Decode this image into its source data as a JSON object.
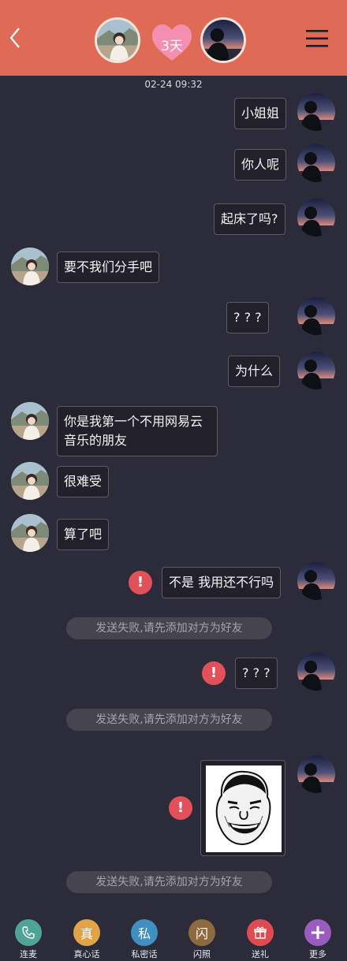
{
  "header": {
    "days_label": "3天",
    "colors": {
      "bar": "#df6a55",
      "heart": "#f48fb1"
    }
  },
  "chat": {
    "timestamp": "02-24 09:32",
    "messages": [
      {
        "side": "right",
        "text": "小姐姐"
      },
      {
        "side": "right",
        "text": "你人呢"
      },
      {
        "side": "right",
        "text": "起床了吗?"
      },
      {
        "side": "left",
        "text": "要不我们分手吧"
      },
      {
        "side": "right",
        "text": "? ? ?"
      },
      {
        "side": "right",
        "text": "为什么"
      },
      {
        "side": "left",
        "text": "你是我第一个不用网易云音乐的朋友"
      },
      {
        "side": "left",
        "text": "很难受"
      },
      {
        "side": "left",
        "text": "算了吧"
      },
      {
        "side": "right",
        "text": "不是 我用还不行吗",
        "failed": true
      },
      {
        "side": "right",
        "text": "? ? ?",
        "failed": true
      },
      {
        "side": "right",
        "type": "image",
        "image": "meme-face",
        "failed": true
      }
    ],
    "system_notice": "发送失败,请先添加对方为好友",
    "error_icon": "exclamation-icon"
  },
  "toolbar": {
    "items": [
      {
        "label": "连麦",
        "icon": "phone-icon",
        "color": "#4ea597"
      },
      {
        "label": "真心话",
        "icon": "truth-icon",
        "glyph": "真",
        "color": "#e0a446"
      },
      {
        "label": "私密话",
        "icon": "private-icon",
        "glyph": "私",
        "color": "#3f8fbf"
      },
      {
        "label": "闪照",
        "icon": "flash-photo-icon",
        "glyph": "闪",
        "color": "#8e6a3f"
      },
      {
        "label": "送礼",
        "icon": "gift-icon",
        "color": "#e04b52"
      },
      {
        "label": "更多",
        "icon": "plus-icon",
        "glyph": "+",
        "color": "#9a5cc0"
      }
    ]
  }
}
